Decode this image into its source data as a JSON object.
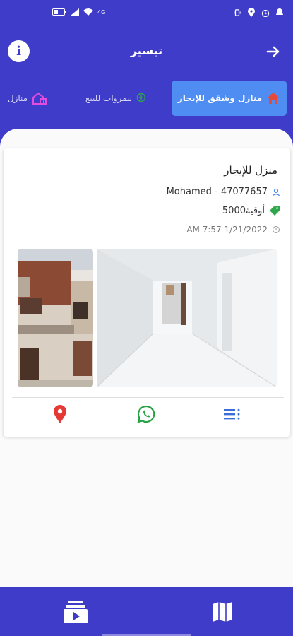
{
  "colors": {
    "primary": "#3f3cc9",
    "active_tab": "#4f8df3",
    "price_tag": "#2ea84a",
    "location": "#e53935",
    "whatsapp": "#25a244",
    "details": "#3a6fd8"
  },
  "status_bar": {
    "network_text": "4G"
  },
  "app_bar": {
    "title": "تيسير",
    "info_label": "i"
  },
  "tabs": [
    {
      "label": "منازل وشقق للإيجار",
      "icon": "house-icon",
      "active": true
    },
    {
      "label": "نيمروات للبيع",
      "icon": "map-pin-outline-icon",
      "active": false
    },
    {
      "label": "منازل",
      "icon": "house-icon",
      "active": false
    }
  ],
  "listing": {
    "title": "منزل للإيجار",
    "owner": "Mohamed - 47077657",
    "price": "5000أوقية",
    "date": "AM 7:57 1/21/2022"
  },
  "actions": [
    {
      "icon": "location-pin-icon"
    },
    {
      "icon": "whatsapp-icon"
    },
    {
      "icon": "list-details-icon"
    }
  ],
  "bottom_nav": [
    {
      "icon": "media-gallery-icon"
    },
    {
      "icon": "map-icon"
    }
  ]
}
